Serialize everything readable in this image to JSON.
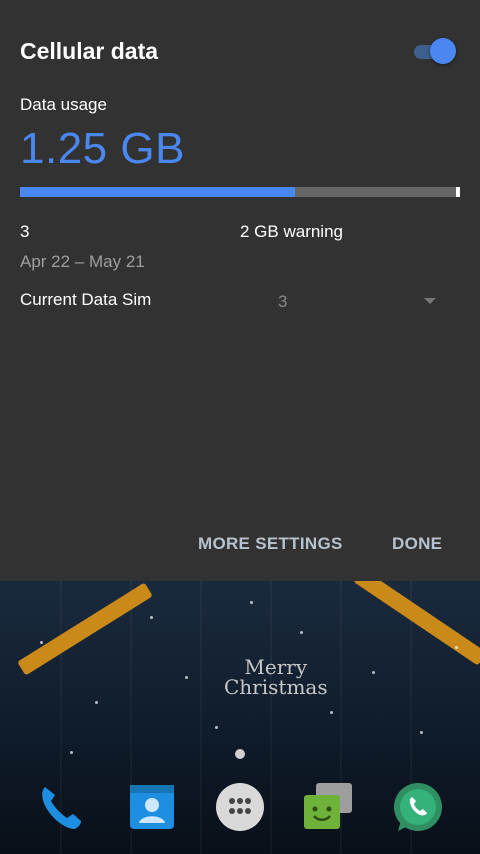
{
  "dialog": {
    "title": "Cellular data",
    "toggle_on": true,
    "usage_label": "Data usage",
    "usage_value": "1.25 GB",
    "usage_fraction": 0.625,
    "cycle_left": "3",
    "warning": "2 GB warning",
    "date_range": "Apr 22 – May 21",
    "sim_label": "Current Data Sim",
    "sim_value": "3",
    "more_settings": "MORE SETTINGS",
    "done": "DONE"
  },
  "wallpaper": {
    "line1": "Merry",
    "line2": "Christmas"
  },
  "dock": {
    "icons": [
      "phone-icon",
      "contacts-icon",
      "app-drawer-icon",
      "messaging-icon",
      "whatsapp-icon"
    ]
  },
  "colors": {
    "accent": "#4a87f0",
    "panel": "#323232"
  }
}
